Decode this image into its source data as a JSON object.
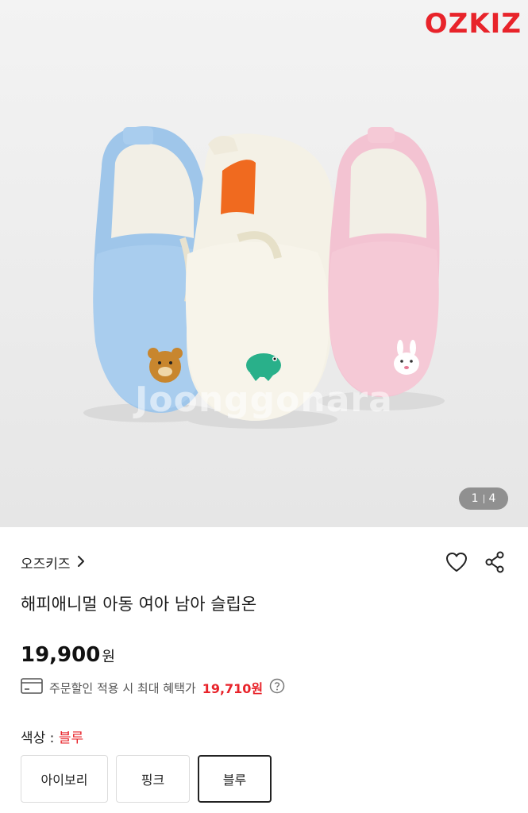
{
  "hero": {
    "logo_text": "OZKIZ",
    "watermark": "Joonggonara",
    "counter_current": "1",
    "counter_total": "4"
  },
  "product": {
    "brand": "오즈키즈",
    "title": "해피애니멀 아동 여아 남아 슬립온",
    "price": "19,900",
    "price_unit": "원",
    "benefit_text": "주문할인 적용 시 최대 혜택가",
    "benefit_price": "19,710원"
  },
  "color_option": {
    "label": "색상 : ",
    "selected": "블루",
    "options": [
      "아이보리",
      "핑크",
      "블루"
    ]
  },
  "colors": {
    "accent": "#e8232a",
    "shoe_blue": "#a9cdee",
    "shoe_ivory": "#f4f1e6",
    "shoe_pink": "#f5c9d6"
  },
  "icons": [
    "chevron-right-icon",
    "heart-icon",
    "share-icon",
    "card-icon",
    "help-icon"
  ]
}
